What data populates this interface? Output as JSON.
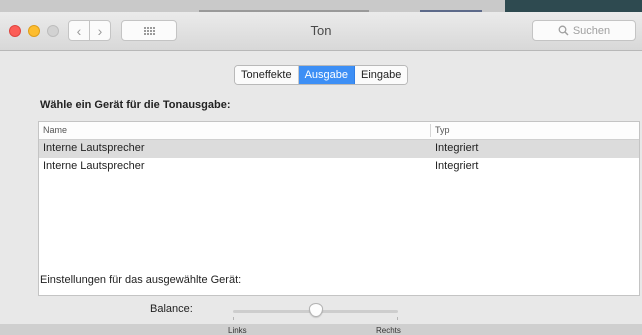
{
  "window": {
    "title": "Ton",
    "search_placeholder": "Suchen"
  },
  "tabs": [
    {
      "label": "Toneffekte",
      "selected": false
    },
    {
      "label": "Ausgabe",
      "selected": true
    },
    {
      "label": "Eingabe",
      "selected": false
    }
  ],
  "output": {
    "section_title": "Wähle ein Gerät für die Tonausgabe:",
    "columns": {
      "name": "Name",
      "type": "Typ"
    },
    "rows": [
      {
        "name": "Interne Lautsprecher",
        "type": "Integriert",
        "selected": true
      },
      {
        "name": "Interne Lautsprecher",
        "type": "Integriert",
        "selected": false
      }
    ]
  },
  "settings": {
    "label": "Einstellungen für das ausgewählte Gerät:",
    "balance_label": "Balance:",
    "balance_min_label": "Links",
    "balance_max_label": "Rechts",
    "balance_value": 0.5
  },
  "colors": {
    "accent": "#3d8ff5",
    "close": "#fc5d57",
    "minimize": "#fdbd2f"
  },
  "icons": [
    "close-icon",
    "minimize-icon",
    "zoom-icon",
    "chevron-left-icon",
    "chevron-right-icon",
    "grid-icon",
    "search-icon"
  ]
}
